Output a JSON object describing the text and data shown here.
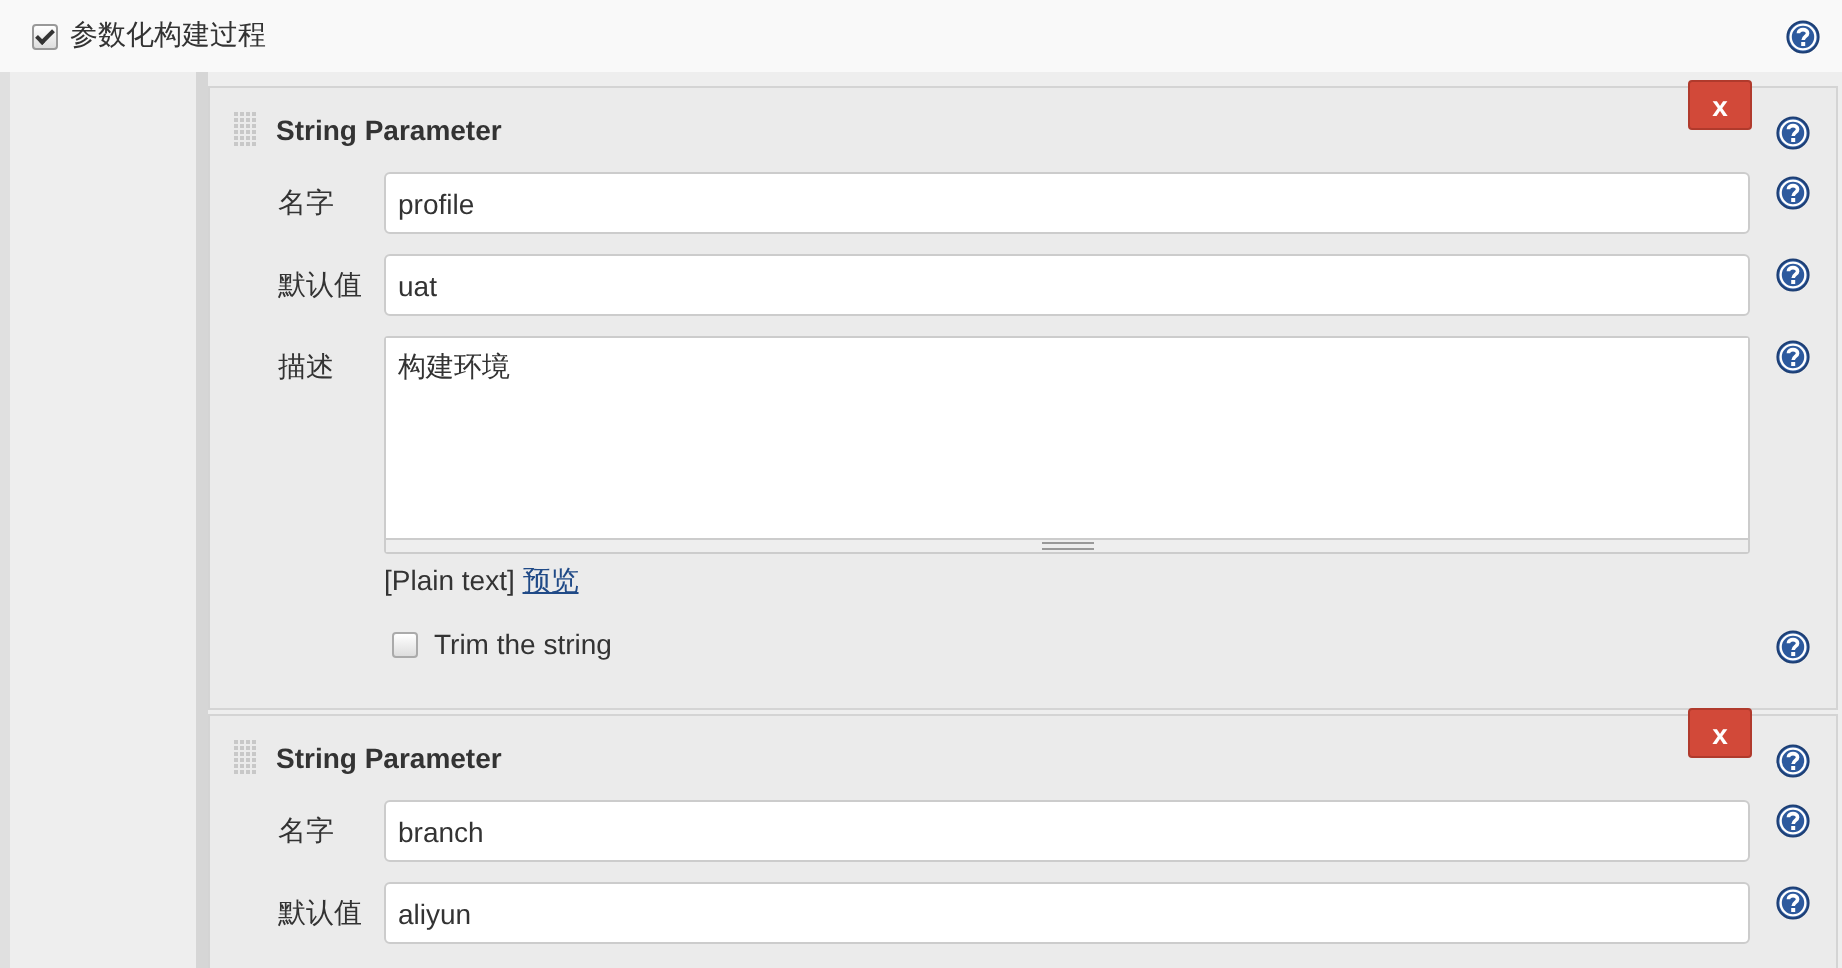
{
  "section": {
    "label": "参数化构建过程",
    "checked": true
  },
  "parameters": [
    {
      "title": "String Parameter",
      "delete_label": "x",
      "fields": [
        {
          "kind": "text",
          "label": "名字",
          "value": "profile"
        },
        {
          "kind": "text",
          "label": "默认值",
          "value": "uat"
        },
        {
          "kind": "textarea",
          "label": "描述",
          "value": "构建环境",
          "format": "[Plain text]",
          "preview_link": "预览"
        }
      ],
      "trim": {
        "label": "Trim the string",
        "checked": false
      }
    },
    {
      "title": "String Parameter",
      "delete_label": "x",
      "fields": [
        {
          "kind": "text",
          "label": "名字",
          "value": "branch"
        },
        {
          "kind": "text",
          "label": "默认值",
          "value": "aliyun"
        }
      ]
    }
  ]
}
